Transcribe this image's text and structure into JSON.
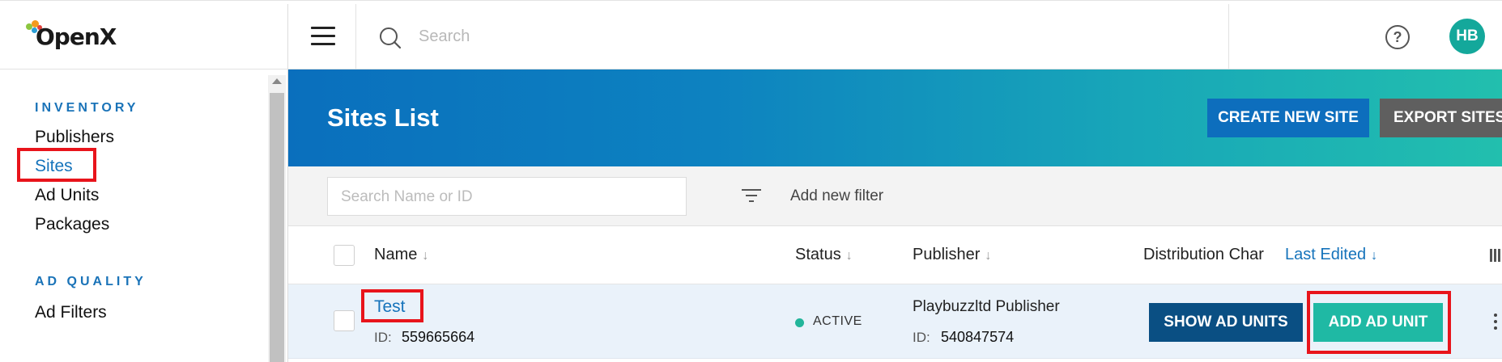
{
  "app": {
    "brand": "OpenX",
    "brand_colors": {
      "orange": "#f39a1e",
      "green": "#8cc63f",
      "blue": "#2a9fd6",
      "red": "#e2413b"
    }
  },
  "sidebar": {
    "sections": [
      {
        "title": "INVENTORY",
        "items": [
          "Publishers",
          "Sites",
          "Ad Units",
          "Packages"
        ]
      },
      {
        "title": "AD QUALITY",
        "items": [
          "Ad Filters"
        ]
      }
    ],
    "active_item": "Sites"
  },
  "topbar": {
    "search_placeholder": "Search",
    "help_icon": "question-circle-icon",
    "avatar_initials": "HB"
  },
  "header": {
    "title": "Sites List",
    "buttons": {
      "create": "CREATE NEW SITE",
      "export": "EXPORT SITES"
    }
  },
  "filters": {
    "search_placeholder": "Search Name or ID",
    "add_filter_label": "Add new filter"
  },
  "table": {
    "columns": [
      "Name",
      "Status",
      "Publisher",
      "Distribution Char",
      "Last Edited"
    ],
    "sorted_column": "Last Edited",
    "rows": [
      {
        "name": "Test",
        "id_label": "ID:",
        "id": "559665664",
        "status": "ACTIVE",
        "publisher": "Playbuzzltd Publisher",
        "publisher_id_label": "ID:",
        "publisher_id": "540847574",
        "actions": {
          "show": "SHOW AD UNITS",
          "add": "ADD AD UNIT"
        }
      }
    ]
  },
  "colors": {
    "accent": "#1573bb",
    "status_active": "#22b59a",
    "highlight": "#e8141b",
    "btn_show": "#0a4f83",
    "btn_add": "#1fb9a4",
    "avatar": "#14a89b"
  }
}
